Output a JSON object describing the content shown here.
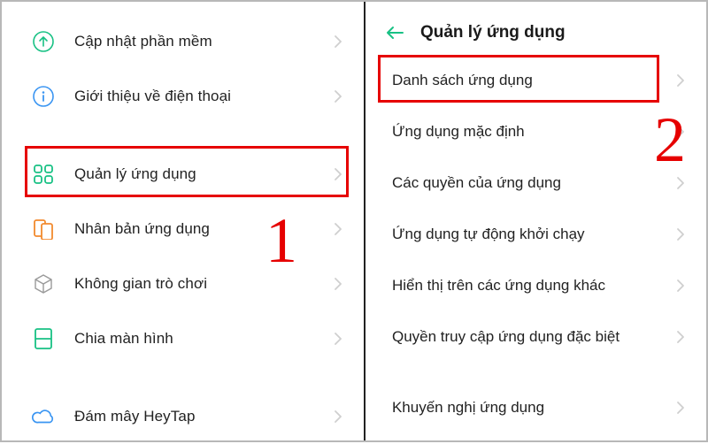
{
  "left": {
    "items": [
      {
        "label": "Cập nhật phần mềm"
      },
      {
        "label": "Giới thiệu về điện thoại"
      },
      {
        "label": "Quản lý ứng dụng"
      },
      {
        "label": "Nhân bản ứng dụng"
      },
      {
        "label": "Không gian trò chơi"
      },
      {
        "label": "Chia màn hình"
      },
      {
        "label": "Đám mây HeyTap"
      }
    ]
  },
  "right": {
    "title": "Quản lý ứng dụng",
    "items": [
      {
        "label": "Danh sách ứng dụng"
      },
      {
        "label": "Ứng dụng mặc định"
      },
      {
        "label": "Các quyền của ứng dụng"
      },
      {
        "label": "Ứng dụng tự động khởi chạy"
      },
      {
        "label": "Hiển thị trên các ứng dụng khác"
      },
      {
        "label": "Quyền truy cập ứng dụng đặc biệt"
      },
      {
        "label": "Khuyến nghị ứng dụng"
      }
    ]
  },
  "markers": {
    "one": "1",
    "two": "2"
  }
}
